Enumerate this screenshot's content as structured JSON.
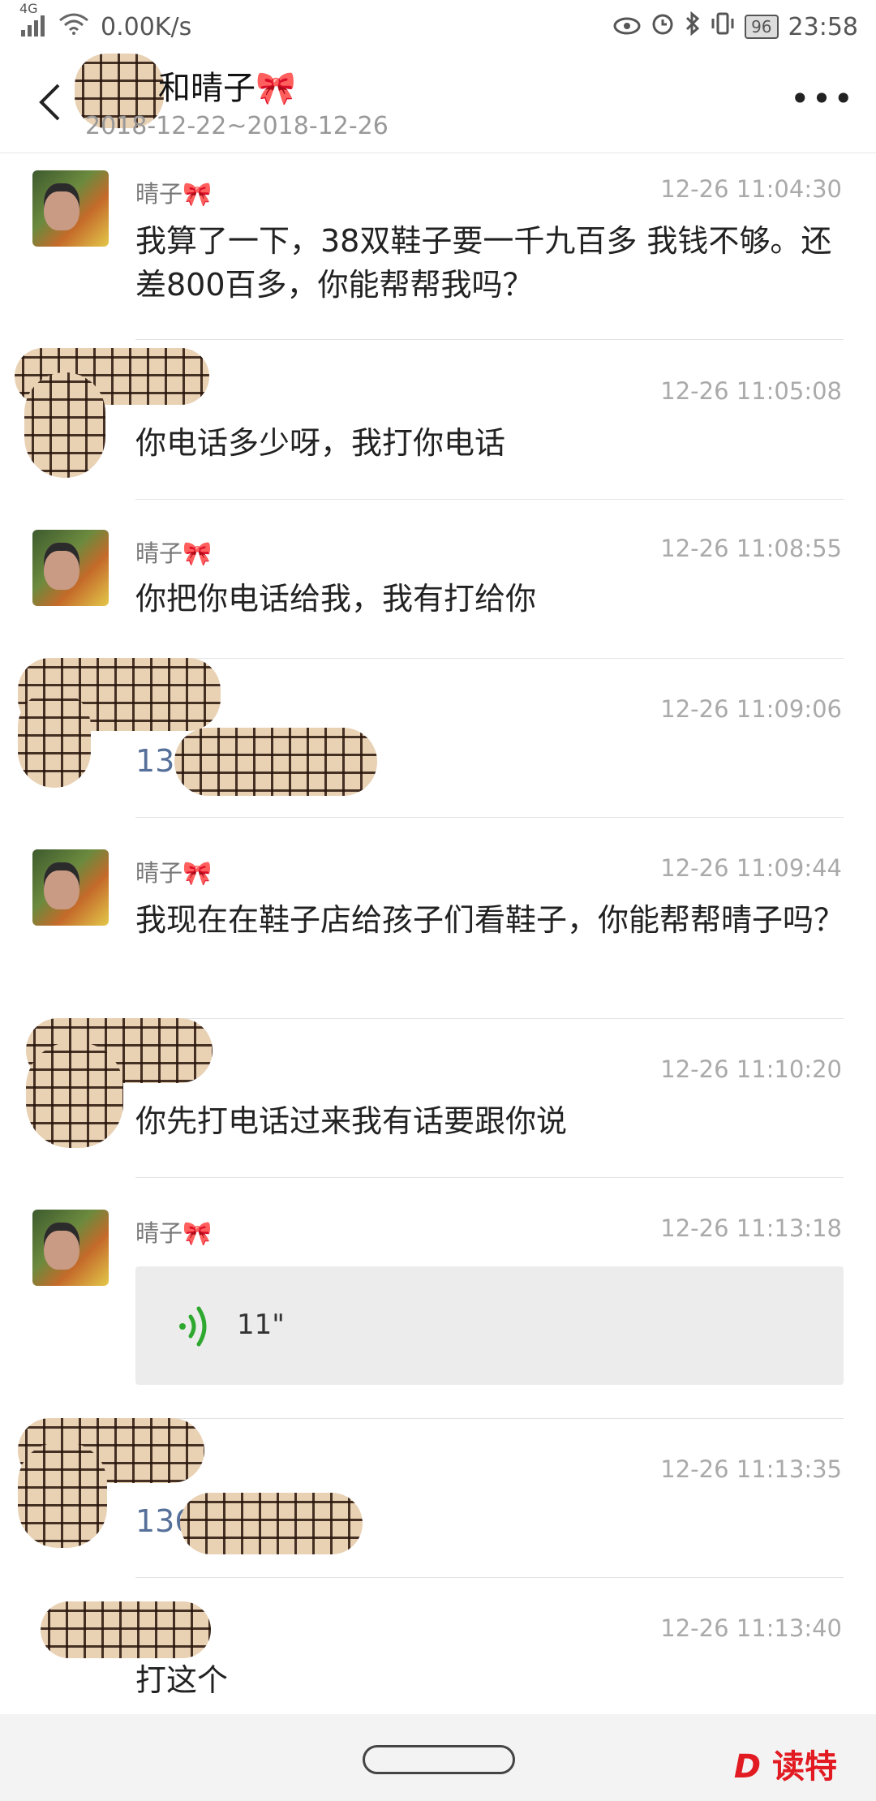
{
  "status_bar": {
    "network": "4G",
    "speed": "0.00K/s",
    "battery": "96",
    "time": "23:58"
  },
  "header": {
    "title": "和晴子🎀",
    "date_range": "2018-12-22~2018-12-26"
  },
  "messages": [
    {
      "sender": "晴子🎀",
      "time": "12-26 11:04:30",
      "text": "我算了一下，38双鞋子要一千九百多 我钱不够。还差800百多，你能帮帮我吗？"
    },
    {
      "sender": "",
      "time": "12-26 11:05:08",
      "text": "你电话多少呀，我打你电话"
    },
    {
      "sender": "晴子🎀",
      "time": "12-26 11:08:55",
      "text": "你把你电话给我，我有打给你"
    },
    {
      "sender": "",
      "time": "12-26 11:09:06",
      "text": "13"
    },
    {
      "sender": "晴子🎀",
      "time": "12-26 11:09:44",
      "text": "我现在在鞋子店给孩子们看鞋子，你能帮帮晴子吗？"
    },
    {
      "sender": "",
      "time": "12-26 11:10:20",
      "text": "你先打电话过来我有话要跟你说"
    },
    {
      "sender": "晴子🎀",
      "time": "12-26 11:13:18",
      "voice_duration": "11\""
    },
    {
      "sender": "",
      "time": "12-26 11:13:35",
      "text": "136"
    },
    {
      "sender": "",
      "time": "12-26 11:13:40",
      "text": "打这个"
    }
  ],
  "watermark": "读特",
  "colors": {
    "accent_link": "#56709a",
    "voice_green": "#2fa82f",
    "logo_red": "#e21a22"
  }
}
